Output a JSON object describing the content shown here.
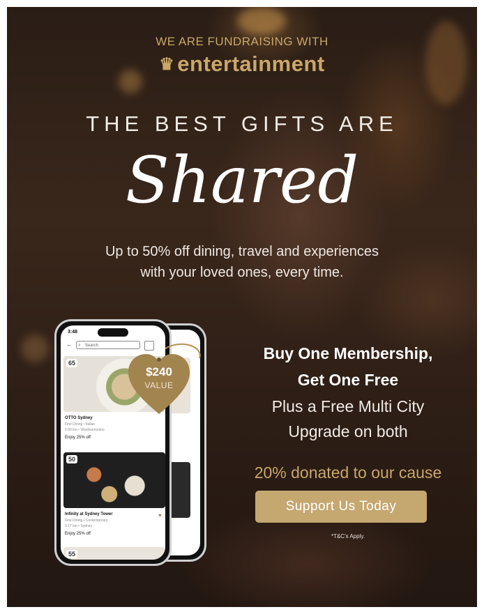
{
  "header": {
    "eyebrow": "WE ARE FUNDRAISING WITH",
    "brand": "entertainment"
  },
  "hero": {
    "headline": "THE BEST GIFTS ARE",
    "script_word": "Shared",
    "subtitle_line1": "Up to 50% off dining, travel and experiences",
    "subtitle_line2": "with your loved ones, every time."
  },
  "phone": {
    "status_time": "3:48",
    "search_placeholder": "Search",
    "cards": [
      {
        "badge": "65",
        "title": "OTTO Sydney",
        "line1": "Fine Dining • Italian",
        "line2": "0.99 km • Woolloomooloo",
        "offer": "Enjoy 25% off"
      },
      {
        "badge": "50",
        "title": "Infinity at Sydney Tower",
        "line1": "Fine Dining • Contemporary",
        "line2": "0.17 km • Sydney",
        "offer": "Enjoy 25% off"
      },
      {
        "badge": "55"
      }
    ]
  },
  "tag": {
    "value": "$240",
    "label": "VALUE"
  },
  "offer": {
    "line1": "Buy One Membership,",
    "line2": "Get One Free",
    "line3": "Plus a Free Multi City",
    "line4": "Upgrade on both"
  },
  "donation": "20% donated to our cause",
  "cta_label": "Support Us Today",
  "terms": "*T&C's Apply.",
  "colors": {
    "gold": "#c9a76a",
    "button": "#c5a770",
    "background": "#2e2018"
  },
  "icons": [
    "crown-icon",
    "back-arrow-icon",
    "search-icon",
    "filter-icon",
    "heart-icon"
  ]
}
